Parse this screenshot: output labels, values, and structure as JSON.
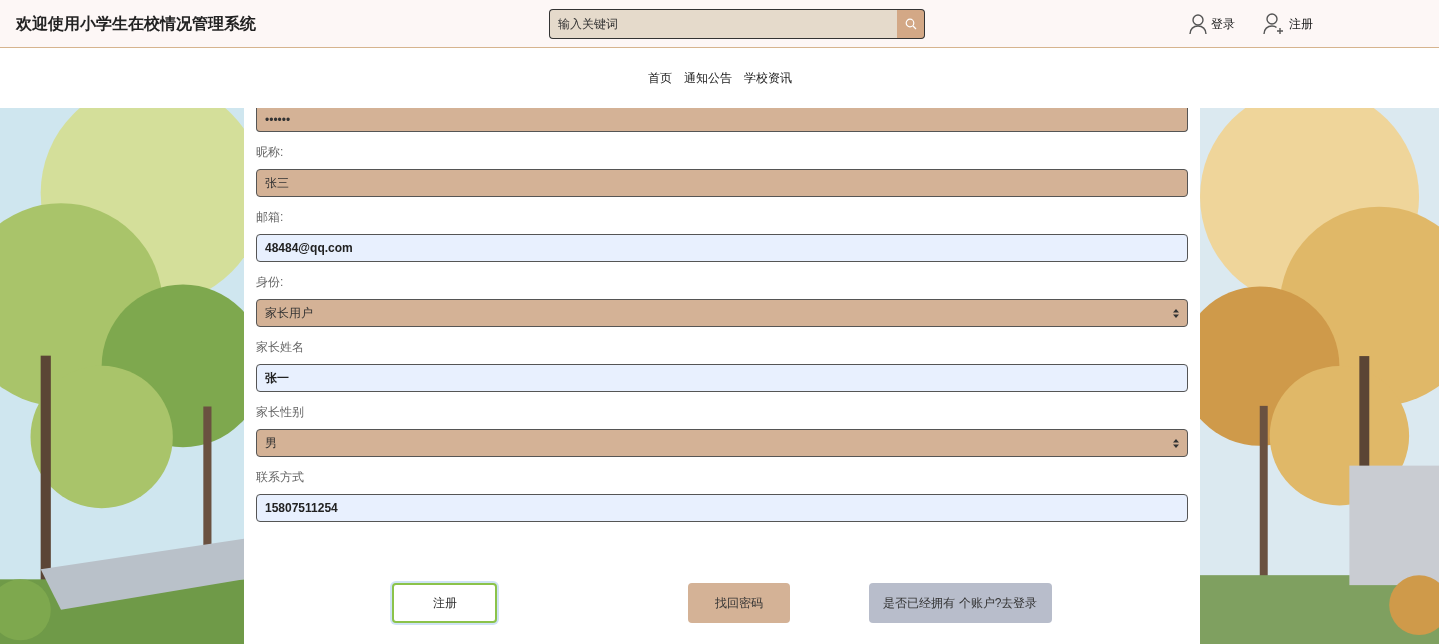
{
  "header": {
    "title": "欢迎使用小学生在校情况管理系统",
    "search": {
      "placeholder": "输入关键词"
    },
    "actions": [
      {
        "kind": "login",
        "label": "登录"
      },
      {
        "kind": "register",
        "label": "注册"
      }
    ]
  },
  "nav": [
    "首页",
    "通知公告",
    "学校资讯"
  ],
  "form": {
    "fields": [
      {
        "kind": "password",
        "value": "••••••",
        "autofilled": false
      },
      {
        "kind": "input",
        "label": "昵称:",
        "value": "张三",
        "autofilled": false
      },
      {
        "kind": "input",
        "label": "邮箱:",
        "value": "48484@qq.com",
        "autofilled": true
      },
      {
        "kind": "select",
        "label": "身份:",
        "value": "家长用户",
        "autofilled": false
      },
      {
        "kind": "input",
        "label": "家长姓名",
        "value": "张一",
        "autofilled": true
      },
      {
        "kind": "select",
        "label": "家长性别",
        "value": "男",
        "autofilled": false
      },
      {
        "kind": "input",
        "label": "联系方式",
        "value": "15807511254",
        "autofilled": true
      }
    ],
    "buttons": [
      {
        "kind": "primary",
        "label": "注册"
      },
      {
        "kind": "secondary",
        "label": "找回密码"
      },
      {
        "kind": "link",
        "label": "是否已经拥有 个账户?去登录"
      }
    ]
  }
}
